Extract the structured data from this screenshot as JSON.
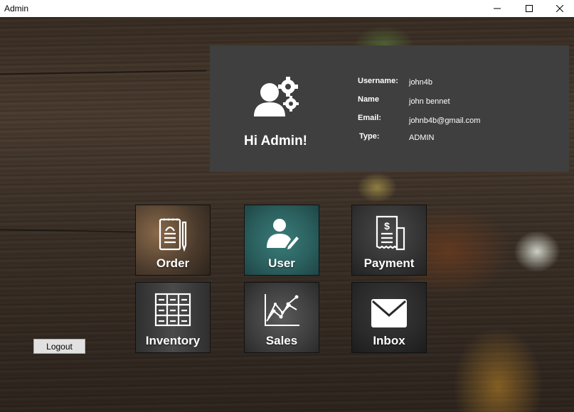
{
  "window": {
    "title": "Admin"
  },
  "profile": {
    "greeting": "Hi Admin!",
    "username_label": "Username:",
    "username": "john4b",
    "name_label": "Name",
    "name": "john bennet",
    "email_label": "Email:",
    "email": "johnb4b@gmail.com",
    "type_label": "Type:",
    "type": "ADMIN"
  },
  "tiles": {
    "order": "Order",
    "user": "User",
    "payment": "Payment",
    "inventory": "Inventory",
    "sales": "Sales",
    "inbox": "Inbox"
  },
  "logout_label": "Logout",
  "icons": [
    "user-gear-icon",
    "order-icon",
    "user-icon",
    "payment-icon",
    "inventory-icon",
    "sales-icon",
    "inbox-icon",
    "minimize-icon",
    "maximize-icon",
    "close-icon"
  ]
}
